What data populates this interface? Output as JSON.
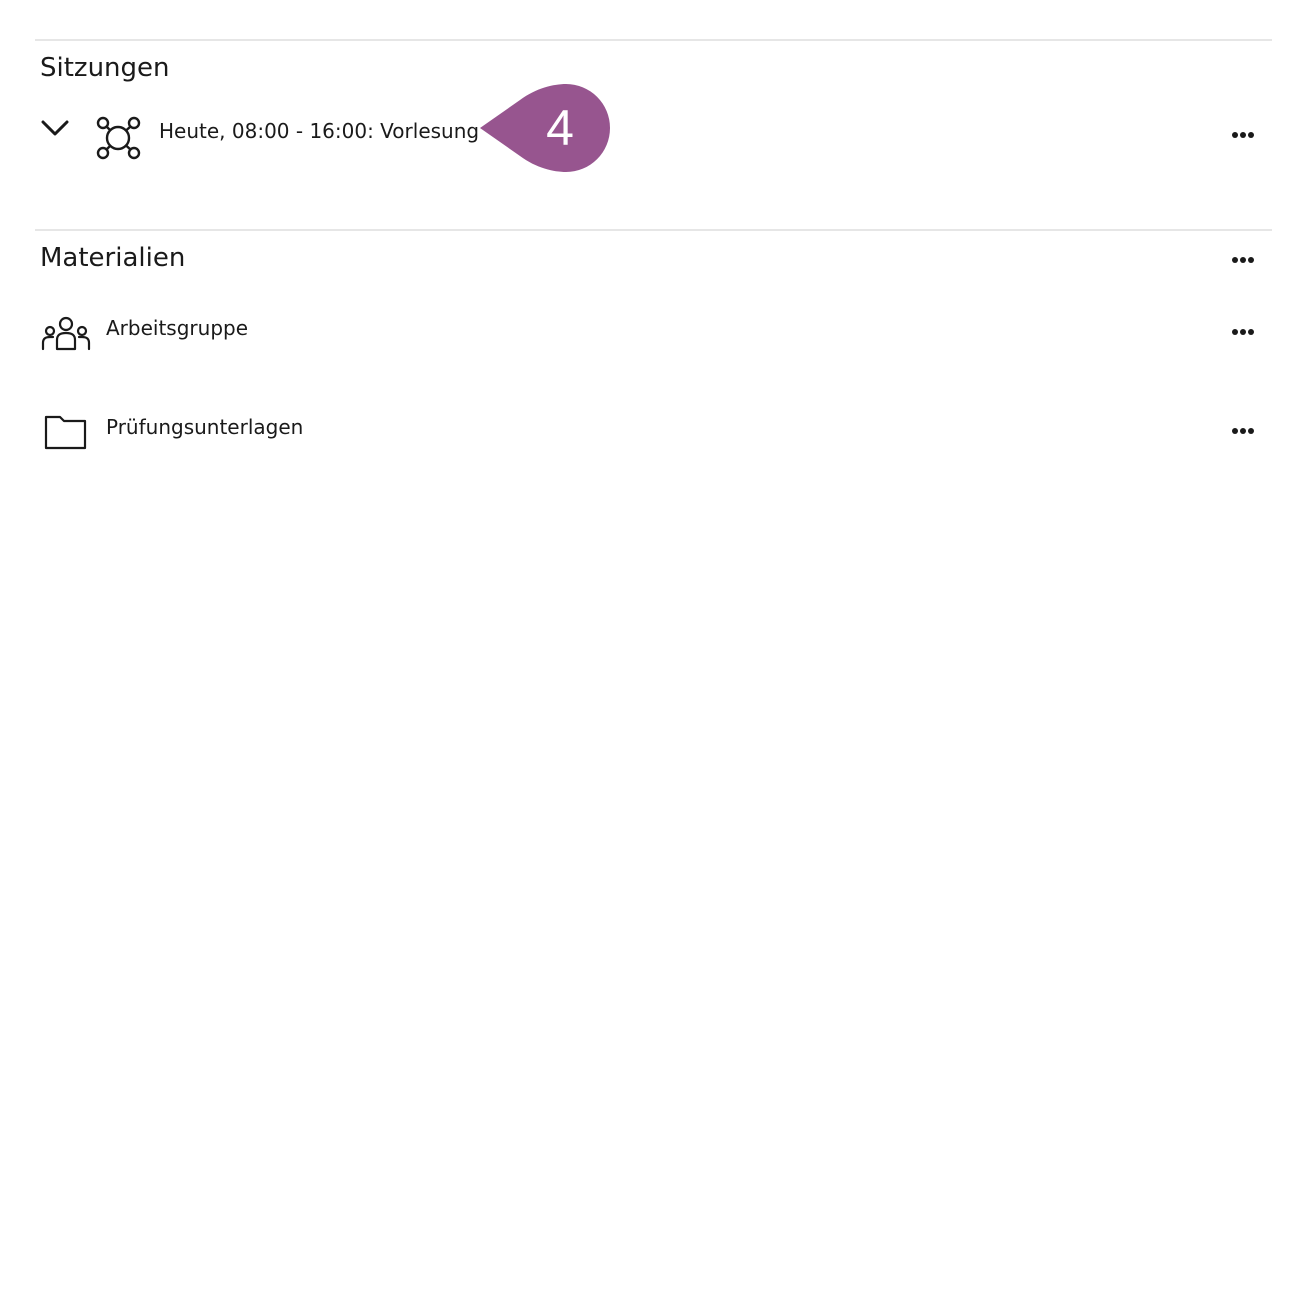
{
  "sessions": {
    "title": "Sitzungen",
    "items": [
      {
        "label": "Heute, 08:00 - 16:00: Vorlesung",
        "icon": "session-network-icon",
        "expanded": true
      }
    ]
  },
  "callout": {
    "number": "4",
    "color": "#97558f"
  },
  "materials": {
    "title": "Materialien",
    "items": [
      {
        "label": "Arbeitsgruppe",
        "icon": "group-icon"
      },
      {
        "label": "Prüfungsunterlagen",
        "icon": "folder-icon"
      }
    ]
  },
  "icons": {
    "expand": "chevron-down-icon",
    "more": "more-options-icon"
  }
}
